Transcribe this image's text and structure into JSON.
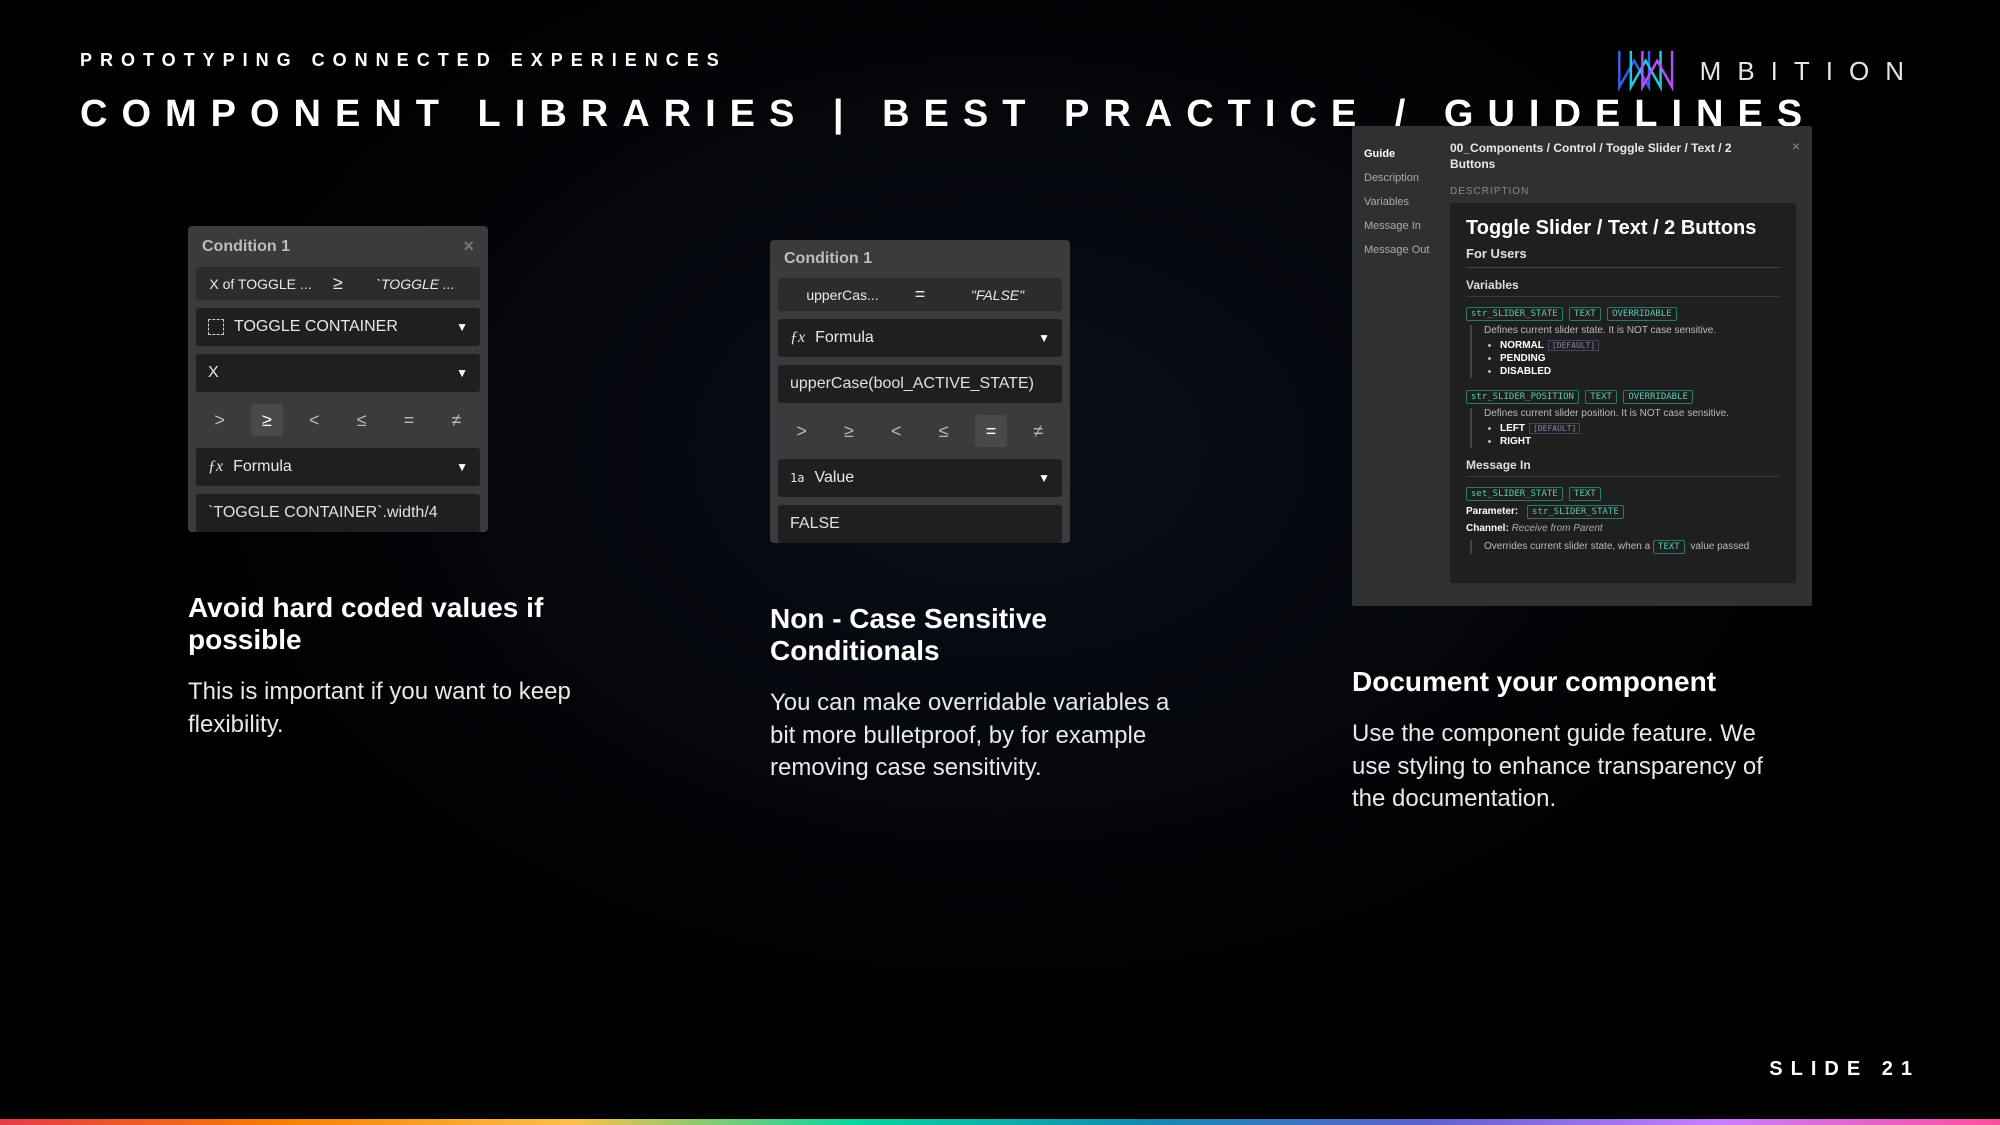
{
  "header": {
    "eyebrow": "PROTOTYPING CONNECTED EXPERIENCES",
    "title": "COMPONENT LIBRARIES | BEST PRACTICE / GUIDELINES"
  },
  "logo": {
    "text": "MBITION"
  },
  "col1": {
    "panel": {
      "title": "Condition 1",
      "trip_left": "X of TOGGLE ...",
      "trip_op": "≥",
      "trip_right": "`TOGGLE ...",
      "drop1": "TOGGLE CONTAINER",
      "drop2": "X",
      "ops": [
        ">",
        "≥",
        "<",
        "≤",
        "=",
        "≠"
      ],
      "op_selected": "≥",
      "drop3": "Formula",
      "input": "`TOGGLE CONTAINER`.width/4"
    },
    "title": "Avoid hard coded values if possible",
    "body": "This is important if you want to keep flexibility."
  },
  "col2": {
    "panel": {
      "title": "Condition 1",
      "trip_left": "upperCas...",
      "trip_op": "=",
      "trip_right": "\"FALSE\"",
      "drop1": "Formula",
      "input1": "upperCase(bool_ACTIVE_STATE)",
      "ops": [
        ">",
        "≥",
        "<",
        "≤",
        "=",
        "≠"
      ],
      "op_selected": "=",
      "drop2": "Value",
      "input2": "FALSE"
    },
    "title": "Non - Case Sensitive Conditionals",
    "body": "You can make overridable variables a bit more bulletproof, by for example removing case sensitivity."
  },
  "col3": {
    "panel": {
      "nav": [
        "Guide",
        "Description",
        "Variables",
        "Message In",
        "Message Out"
      ],
      "nav_active": "Guide",
      "breadcrumb": "00_Components / Control / Toggle Slider / Text / 2 Buttons",
      "desc_label": "DESCRIPTION",
      "h1": "Toggle Slider / Text / 2 Buttons",
      "h2": "For Users",
      "vars_header": "Variables",
      "var1_tags": [
        "str_SLIDER_STATE",
        "TEXT",
        "OVERRIDABLE"
      ],
      "var1_desc": "Defines current slider state. It is NOT case sensitive.",
      "var1_items": [
        {
          "name": "NORMAL",
          "tag": "[DEFAULT]"
        },
        {
          "name": "PENDING",
          "tag": ""
        },
        {
          "name": "DISABLED",
          "tag": ""
        }
      ],
      "var2_tags": [
        "str_SLIDER_POSITION",
        "TEXT",
        "OVERRIDABLE"
      ],
      "var2_desc": "Defines current slider position. It is NOT case sensitive.",
      "var2_items": [
        {
          "name": "LEFT",
          "tag": "[DEFAULT]"
        },
        {
          "name": "RIGHT",
          "tag": ""
        }
      ],
      "msgin_header": "Message In",
      "msgin_tags": [
        "set_SLIDER_STATE",
        "TEXT"
      ],
      "param_label": "Parameter:",
      "param_val": "str_SLIDER_STATE",
      "channel_label": "Channel:",
      "channel_val": "Receive from Parent",
      "overrides_pre": "Overrides current slider state, when a ",
      "overrides_tag": "TEXT",
      "overrides_post": " value passed"
    },
    "title": "Document your component",
    "body": "Use the component guide feature. We use styling to enhance transparency of the documentation."
  },
  "slide": "SLIDE 21"
}
